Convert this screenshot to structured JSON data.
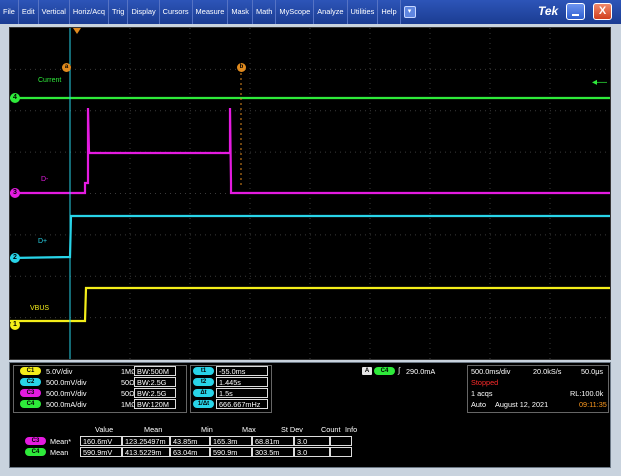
{
  "menu": [
    "File",
    "Edit",
    "Vertical",
    "Horiz/Acq",
    "Trig",
    "Display",
    "Cursors",
    "Measure",
    "Mask",
    "Math",
    "MyScope",
    "Analyze",
    "Utilities",
    "Help"
  ],
  "brand": "Tek",
  "close_glyph": "X",
  "colors": {
    "ch1": "#f4ee1a",
    "ch2": "#28d4e8",
    "ch3": "#e41be0",
    "ch4": "#2eea3a",
    "cursor": "#e08a1e"
  },
  "waveform_labels": {
    "current": "Current",
    "dminus": "D-",
    "dplus": "D+",
    "vbus": "VBUS"
  },
  "ground_markers": [
    "1",
    "2",
    "3",
    "4"
  ],
  "cursor_markers": [
    "a",
    "b"
  ],
  "channels": [
    {
      "badge": "C1",
      "scale": "5.0V/div",
      "coupling": "1MΩ",
      "bw": "BW:500M"
    },
    {
      "badge": "C2",
      "scale": "500.0mV/div",
      "coupling": "50Ω",
      "bw": "BW:2.5G"
    },
    {
      "badge": "C3",
      "scale": "500.0mV/div",
      "coupling": "50Ω",
      "bw": "BW:2.5G"
    },
    {
      "badge": "C4",
      "scale": "500.0mA/div",
      "coupling": "1MΩ",
      "bw": "BW:120M"
    }
  ],
  "cursor_readouts": [
    {
      "badge": "t1",
      "value": "-55.0ms"
    },
    {
      "badge": "t2",
      "value": "1.445s"
    },
    {
      "badge": "Δt",
      "value": "1.5s"
    },
    {
      "badge": "1/Δt",
      "value": "666.667mHz"
    }
  ],
  "trigger": {
    "badge_a": "A",
    "badge_ch": "C4",
    "slope": "∫",
    "level": "290.0mA"
  },
  "acquisition": {
    "horiz_scale": "500.0ms/div",
    "sample_rate": "20.0kS/s",
    "resolution": "50.0μs",
    "state": "Stopped",
    "acqs": "1 acqs",
    "record_length": "RL:100.0k",
    "mode": "Auto",
    "date": "August 12, 2021",
    "time": "09:11:35"
  },
  "measurements": {
    "headers": [
      "Value",
      "Mean",
      "Min",
      "Max",
      "St Dev",
      "Count",
      "Info"
    ],
    "rows": [
      {
        "badge": "C3",
        "label": "Mean*",
        "cells": [
          "160.6mV",
          "123.25497m",
          "43.85m",
          "165.3m",
          "68.81m",
          "3.0",
          ""
        ]
      },
      {
        "badge": "C4",
        "label": "Mean",
        "cells": [
          "590.9mV",
          "413.5229m",
          "63.04m",
          "590.9m",
          "303.5m",
          "3.0",
          ""
        ]
      }
    ]
  }
}
